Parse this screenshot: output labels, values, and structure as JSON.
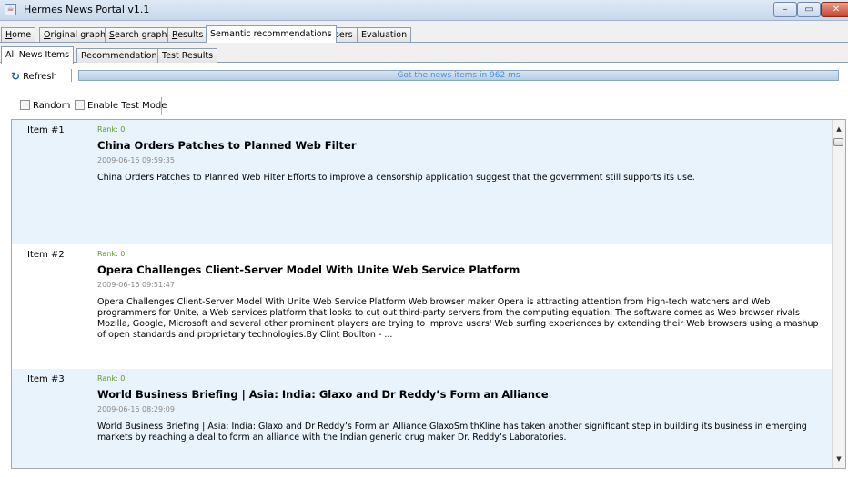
{
  "window": {
    "title": "Hermes News Portal v1.1",
    "controls": {
      "minimize": "–",
      "maximize": "▭",
      "close": "✕"
    }
  },
  "main_tabs": [
    {
      "label": "Home",
      "mnemonic": "H",
      "rest": "ome"
    },
    {
      "label": "Original graph",
      "mnemonic": "O",
      "rest": "riginal graph"
    },
    {
      "label": "Search graph",
      "mnemonic": "S",
      "rest": "earch graph"
    },
    {
      "label": "Results",
      "mnemonic": "R",
      "rest": "esults"
    },
    {
      "label": "Semantic recommendations",
      "mnemonic": "",
      "rest": "Semantic recommendations"
    },
    {
      "label": "Users",
      "mnemonic": "U",
      "rest": "sers"
    },
    {
      "label": "Evaluation",
      "mnemonic": "",
      "rest": "Evaluation"
    }
  ],
  "active_main_tab": "Semantic recommendations",
  "sub_tabs": [
    {
      "label": "All News Items"
    },
    {
      "label": "Recommendations"
    },
    {
      "label": "Test Results"
    }
  ],
  "active_sub_tab": "All News Items",
  "toolbar": {
    "refresh_label": "Refresh",
    "refresh_icon": "refresh-icon",
    "status_text": "Got the news items in 962 ms",
    "progress": 1.0
  },
  "options": {
    "random_label": "Random",
    "random_checked": false,
    "test_mode_label": "Enable Test Mode",
    "test_mode_checked": false
  },
  "items": [
    {
      "number": "Item #1",
      "rank": "Rank: 0",
      "headline": "China Orders Patches to Planned Web Filter",
      "date": "2009-06-16 09:59:35",
      "body": "China Orders Patches to Planned Web Filter Efforts to improve a censorship application suggest that the government still supports its use."
    },
    {
      "number": "Item #2",
      "rank": "Rank: 0",
      "headline": "Opera Challenges Client-Server Model With Unite Web Service Platform",
      "date": "2009-06-16 09:51:47",
      "body": "Opera Challenges Client-Server Model With Unite Web Service Platform Web browser maker Opera is attracting attention from high-tech watchers and Web programmers for Unite, a Web services platform that looks to cut out third-party servers from the computing equation. The software comes as Web browser rivals Mozilla, Google, Microsoft and several other prominent players are trying to improve users' Web surfing experiences by extending their Web browsers using a mashup of open standards and proprietary technologies.By Clint Boulton - ..."
    },
    {
      "number": "Item #3",
      "rank": "Rank: 0",
      "headline": "World Business Briefing | Asia: India: Glaxo and Dr Reddy’s Form an Alliance",
      "date": "2009-06-16 08:29:09",
      "body": "World Business Briefing | Asia: India: Glaxo and Dr Reddy’s Form an Alliance GlaxoSmithKline has taken another significant step in building its business in emerging markets by reaching a deal to form an alliance with the Indian generic drug maker Dr. Reddy’s Laboratories."
    }
  ]
}
